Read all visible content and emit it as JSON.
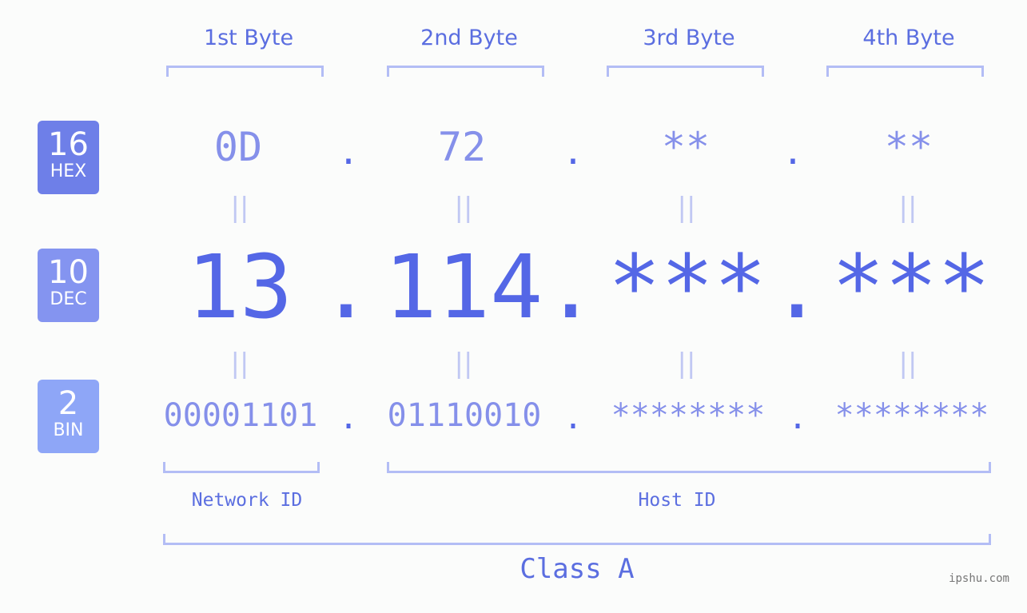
{
  "bytes": [
    {
      "label": "1st Byte",
      "hex": "0D",
      "dec": "13",
      "bin": "00001101"
    },
    {
      "label": "2nd Byte",
      "hex": "72",
      "dec": "114",
      "bin": "01110010"
    },
    {
      "label": "3rd Byte",
      "hex": "**",
      "dec": "***",
      "bin": "********"
    },
    {
      "label": "4th Byte",
      "hex": "**",
      "dec": "***",
      "bin": "********"
    }
  ],
  "separator": ".",
  "equals": "||",
  "badges": {
    "hex": {
      "num": "16",
      "name": "HEX",
      "color": "#6e7fe8"
    },
    "dec": {
      "num": "10",
      "name": "DEC",
      "color": "#8494f0"
    },
    "bin": {
      "num": "2",
      "name": "BIN",
      "color": "#8ea6f7"
    }
  },
  "network_id": "Network ID",
  "host_id": "Host ID",
  "class_label": "Class A",
  "watermark": "ipshu.com"
}
